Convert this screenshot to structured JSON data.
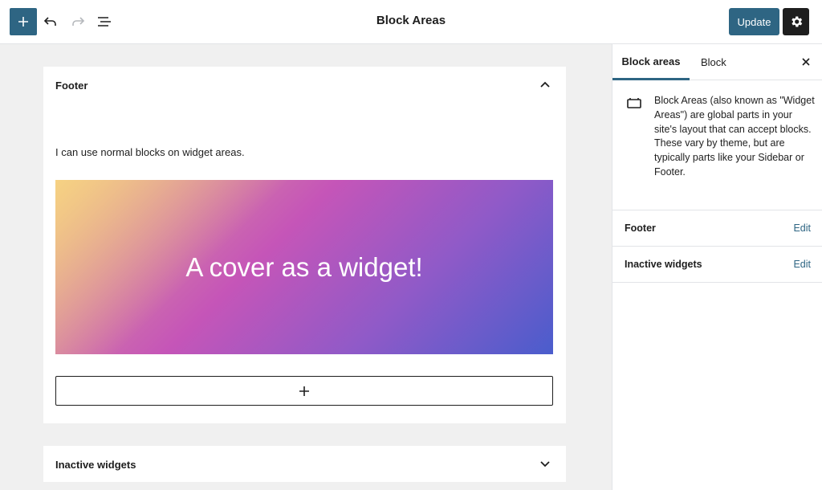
{
  "header": {
    "title": "Block Areas",
    "update_label": "Update",
    "icons": [
      "plus-icon",
      "undo-icon",
      "redo-icon",
      "list-view-icon",
      "gear-icon"
    ]
  },
  "editor": {
    "footer_area": {
      "title": "Footer",
      "paragraph": "I can use normal blocks on widget areas.",
      "cover_text": "A cover as a widget!"
    },
    "inactive_area": {
      "title": "Inactive widgets"
    }
  },
  "sidebar": {
    "tabs": [
      "Block areas",
      "Block"
    ],
    "description": "Block Areas (also known as \"Widget Areas\") are global parts in your site's layout that can accept blocks. These vary by theme, but are typically parts like your Sidebar or Footer.",
    "areas": [
      {
        "label": "Footer",
        "action": "Edit"
      },
      {
        "label": "Inactive widgets",
        "action": "Edit"
      }
    ]
  },
  "colors": {
    "accent": "#2e6583",
    "dark": "#1e1e1e",
    "background": "#f0f0f0"
  }
}
